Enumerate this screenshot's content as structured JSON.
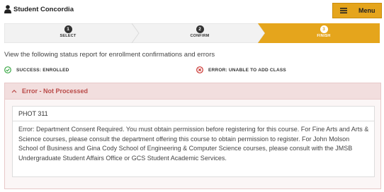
{
  "header": {
    "brand_label": "Student Concordia",
    "menu_label": "Menu"
  },
  "steps": [
    {
      "number": "1",
      "label": "SELECT",
      "state": "complete"
    },
    {
      "number": "2",
      "label": "CONFIRM",
      "state": "complete"
    },
    {
      "number": "3",
      "label": "FINISH",
      "state": "active"
    }
  ],
  "intro_text": "View the following status report for enrollment confirmations and errors",
  "legend": {
    "success": {
      "label": "SUCCESS: ENROLLED",
      "icon": "check-circle-icon",
      "color": "#3aa845"
    },
    "error": {
      "label": "ERROR: UNABLE TO ADD CLASS",
      "icon": "x-circle-icon",
      "color": "#c9302c"
    }
  },
  "error_panel": {
    "title": "Error - Not Processed",
    "course": "PHOT 311",
    "message": "Error: Department Consent Required. You must obtain permission before registering for this course. For Fine Arts and Arts & Science courses, please consult the department offering this course to obtain permission to register. For John Molson School of Business and Gina Cody School of Engineering & Computer Science courses, please consult with the JMSB Undergraduate Student Affairs Office or GCS Student Academic Services."
  },
  "colors": {
    "accent": "#e5a51c",
    "step_inactive": "#f0f0f0",
    "error_header_bg": "#f2dede",
    "error_text": "#b94a48"
  }
}
